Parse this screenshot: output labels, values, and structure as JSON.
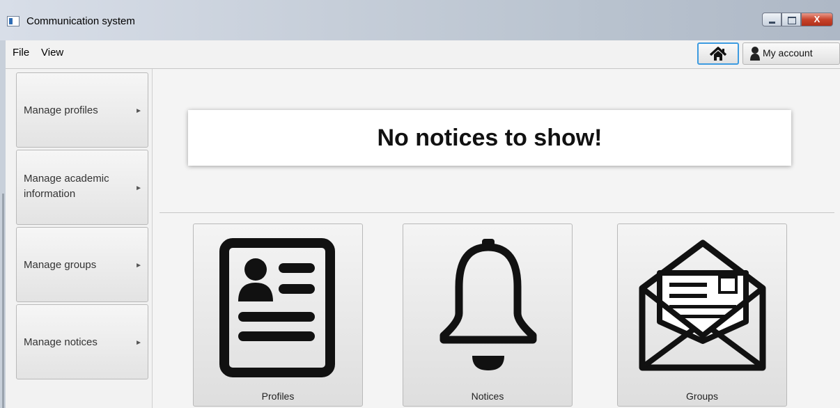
{
  "window": {
    "title": "Communication system",
    "close_label": "X"
  },
  "menubar": {
    "items": [
      "File",
      "View"
    ],
    "home_icon": "home-icon",
    "account_label": "My account",
    "account_icon": "user-icon"
  },
  "sidebar": {
    "items": [
      {
        "label": "Manage profiles",
        "arrow": "►"
      },
      {
        "label": "Manage academic information",
        "arrow": "►"
      },
      {
        "label": "Manage groups",
        "arrow": "►"
      },
      {
        "label": "Manage notices",
        "arrow": "►"
      }
    ]
  },
  "main": {
    "notice_message": "No notices to show!",
    "tiles": [
      {
        "label": "Profiles",
        "icon": "profile-card-icon"
      },
      {
        "label": "Notices",
        "icon": "bell-icon"
      },
      {
        "label": "Groups",
        "icon": "envelope-icon"
      }
    ]
  },
  "colors": {
    "accent": "#3d9be0",
    "close_button": "#c8432b"
  }
}
